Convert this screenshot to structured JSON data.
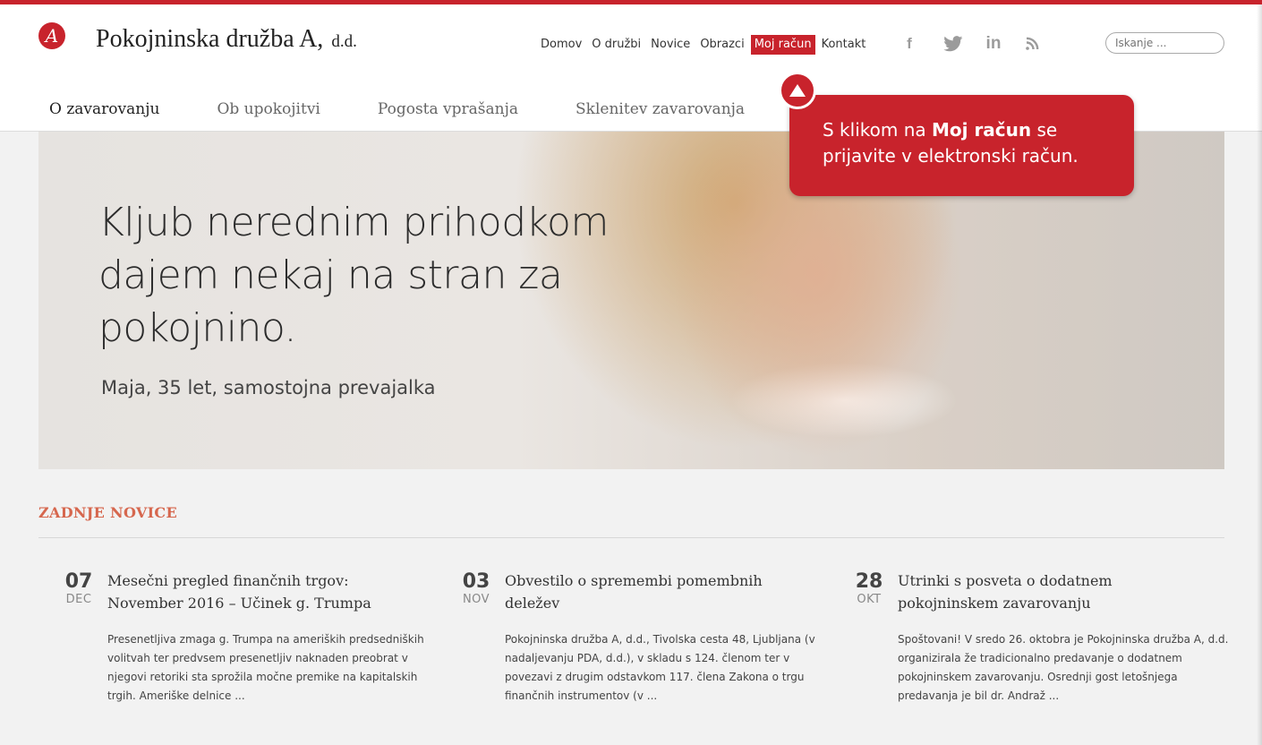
{
  "brand": {
    "logo_letter": "A",
    "name": "Pokojninska družba A,",
    "suffix": "d.d."
  },
  "top_nav": [
    {
      "label": "Domov",
      "active": false
    },
    {
      "label": "O družbi",
      "active": false
    },
    {
      "label": "Novice",
      "active": false
    },
    {
      "label": "Obrazci",
      "active": false
    },
    {
      "label": "Moj račun",
      "active": true
    },
    {
      "label": "Kontakt",
      "active": false
    }
  ],
  "social": {
    "facebook": "f",
    "linkedin": "in",
    "icons": [
      "facebook-icon",
      "twitter-icon",
      "linkedin-icon",
      "rss-icon"
    ]
  },
  "search": {
    "placeholder": "Iskanje ..."
  },
  "main_nav": [
    {
      "label": "O zavarovanju",
      "current": true
    },
    {
      "label": "Ob upokojitvi",
      "current": false
    },
    {
      "label": "Pogosta vprašanja",
      "current": false
    },
    {
      "label": "Sklenitev zavarovanja",
      "current": false
    }
  ],
  "hero": {
    "title": "Kljub nerednim prihodkom dajem nekaj na stran za pokojnino.",
    "subtitle": "Maja, 35 let, samostojna prevajalka"
  },
  "tooltip": {
    "pre": "S klikom na ",
    "bold": "Moj račun",
    "post": " se prijavite v elektronski račun."
  },
  "news_section": {
    "title": "ZADNJE NOVICE"
  },
  "news": [
    {
      "day": "07",
      "month": "DEC",
      "title": "Mesečni pregled finančnih trgov: November 2016 – Učinek g. Trumpa",
      "excerpt": "Presenetljiva zmaga g. Trumpa na ameriških predsedniških volitvah ter predvsem presenetljiv naknaden preobrat v njegovi retoriki sta sprožila močne premike na kapitalskih trgih. Ameriške delnice ..."
    },
    {
      "day": "03",
      "month": "NOV",
      "title": "Obvestilo o spremembi pomembnih deležev",
      "excerpt": "Pokojninska družba A, d.d., Tivolska cesta 48, Ljubljana (v nadaljevanju PDA, d.d.), v skladu s 124. členom ter v povezavi z drugim odstavkom 117. člena Zakona o trgu finančnih instrumentov (v ..."
    },
    {
      "day": "28",
      "month": "OKT",
      "title": "Utrinki s posveta o dodatnem pokojninskem zavarovanju",
      "excerpt": "Spoštovani! V sredo 26. oktobra je Pokojninska družba A, d.d. organizirala že tradicionalno predavanje o dodatnem pokojninskem zavarovanju. Osrednji gost letošnjega predavanja je bil dr. Andraž ..."
    }
  ],
  "colors": {
    "accent": "#c8232c",
    "section_title": "#d6674e"
  }
}
